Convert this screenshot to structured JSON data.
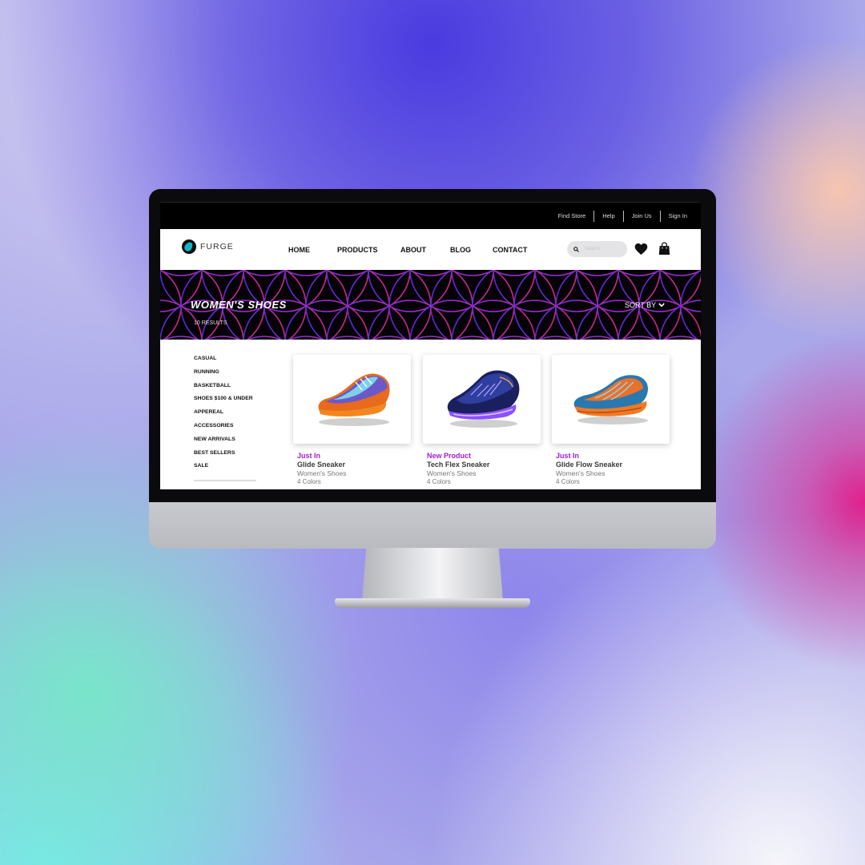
{
  "utility_nav": [
    "Find Store",
    "Help",
    "Join Us",
    "Sign In"
  ],
  "brand": {
    "name": "FURGE"
  },
  "main_nav": [
    "HOME",
    "PRODUCTS",
    "ABOUT",
    "BLOG",
    "CONTACT"
  ],
  "search": {
    "placeholder": "Search"
  },
  "hero": {
    "title": "WOMEN'S SHOES",
    "results": "10 RESULTS",
    "sort_label": "SORT BY"
  },
  "categories": [
    "CASUAL",
    "RUNNING",
    "BASKETBALL",
    "SHOES $100 & UNDER",
    "APPEREAL",
    "ACCESSORIES",
    "NEW ARRIVALS",
    "BEST SELLERS",
    "SALE"
  ],
  "products": [
    {
      "tag": "Just In",
      "name": "Glide Sneaker",
      "category": "Women's Shoes",
      "colors": "4 Colors"
    },
    {
      "tag": "New Product",
      "name": "Tech Flex Sneaker",
      "category": "Women's Shoes",
      "colors": "4 Colors"
    },
    {
      "tag": "Just In",
      "name": "Glide Flow Sneaker",
      "category": "Women's Shoes",
      "colors": "4 Colors"
    }
  ],
  "icons": [
    "search-icon",
    "heart-icon",
    "shopping-bag-icon",
    "chevron-down-icon",
    "brand-logo-icon"
  ],
  "colors": {
    "accent_purple": "#a31ad6",
    "hero_bg": "#050208",
    "logo_teal": "#13b3c7"
  }
}
